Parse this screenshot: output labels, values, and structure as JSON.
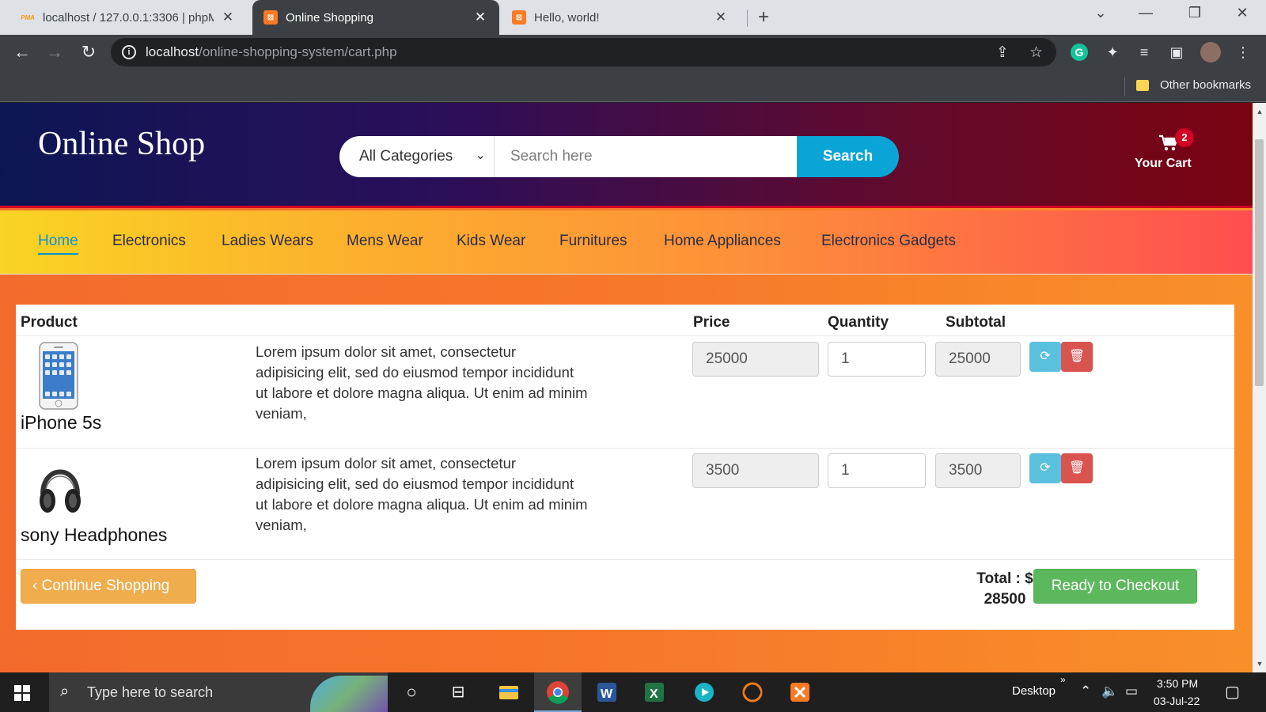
{
  "browser": {
    "tabs": [
      {
        "title": "localhost / 127.0.0.1:3306 | phpM",
        "favicon": "phpmyadmin-icon",
        "active": false
      },
      {
        "title": "Online Shopping",
        "favicon": "xampp-icon",
        "active": true
      },
      {
        "title": "Hello, world!",
        "favicon": "xampp-icon",
        "active": false
      }
    ],
    "address": {
      "host": "localhost",
      "path": "/online-shopping-system/cart.php"
    },
    "bookmarks": {
      "other_label": "Other bookmarks"
    }
  },
  "site": {
    "logo": "Online Shop",
    "search": {
      "category": "All Categories",
      "placeholder": "Search here",
      "button": "Search"
    },
    "cart": {
      "count": "2",
      "label": "Your Cart"
    },
    "nav": [
      "Home",
      "Electronics",
      "Ladies Wears",
      "Mens Wear",
      "Kids Wear",
      "Furnitures",
      "Home Appliances",
      "Electronics Gadgets"
    ],
    "active_nav": "Home",
    "colors": {
      "accent": "#0aa5d6",
      "badge": "#d10024",
      "checkout": "#5cb85c",
      "continue": "#f0ad4e",
      "delete": "#d9534f",
      "refresh": "#5bc0de"
    }
  },
  "cart_table": {
    "headers": {
      "product": "Product",
      "price": "Price",
      "quantity": "Quantity",
      "subtotal": "Subtotal"
    },
    "items": [
      {
        "name": "iPhone 5s",
        "image": "iphone-image",
        "description": "Lorem ipsum dolor sit amet, consectetur adipisicing elit, sed do eiusmod tempor incididunt ut labore et dolore magna aliqua. Ut enim ad minim veniam,",
        "price": "25000",
        "quantity": "1",
        "subtotal": "25000"
      },
      {
        "name": "sony Headphones",
        "image": "headphones-image",
        "description": "Lorem ipsum dolor sit amet, consectetur adipisicing elit, sed do eiusmod tempor incididunt ut labore et dolore magna aliqua. Ut enim ad minim veniam,",
        "price": "3500",
        "quantity": "1",
        "subtotal": "3500"
      }
    ],
    "continue_label": "Continue Shopping",
    "total_prefix": "Total : $",
    "total_value": "28500",
    "checkout_label": "Ready to Checkout"
  },
  "taskbar": {
    "search_placeholder": "Type here to search",
    "desktop_label": "Desktop",
    "time": "3:50 PM",
    "date": "03-Jul-22"
  }
}
